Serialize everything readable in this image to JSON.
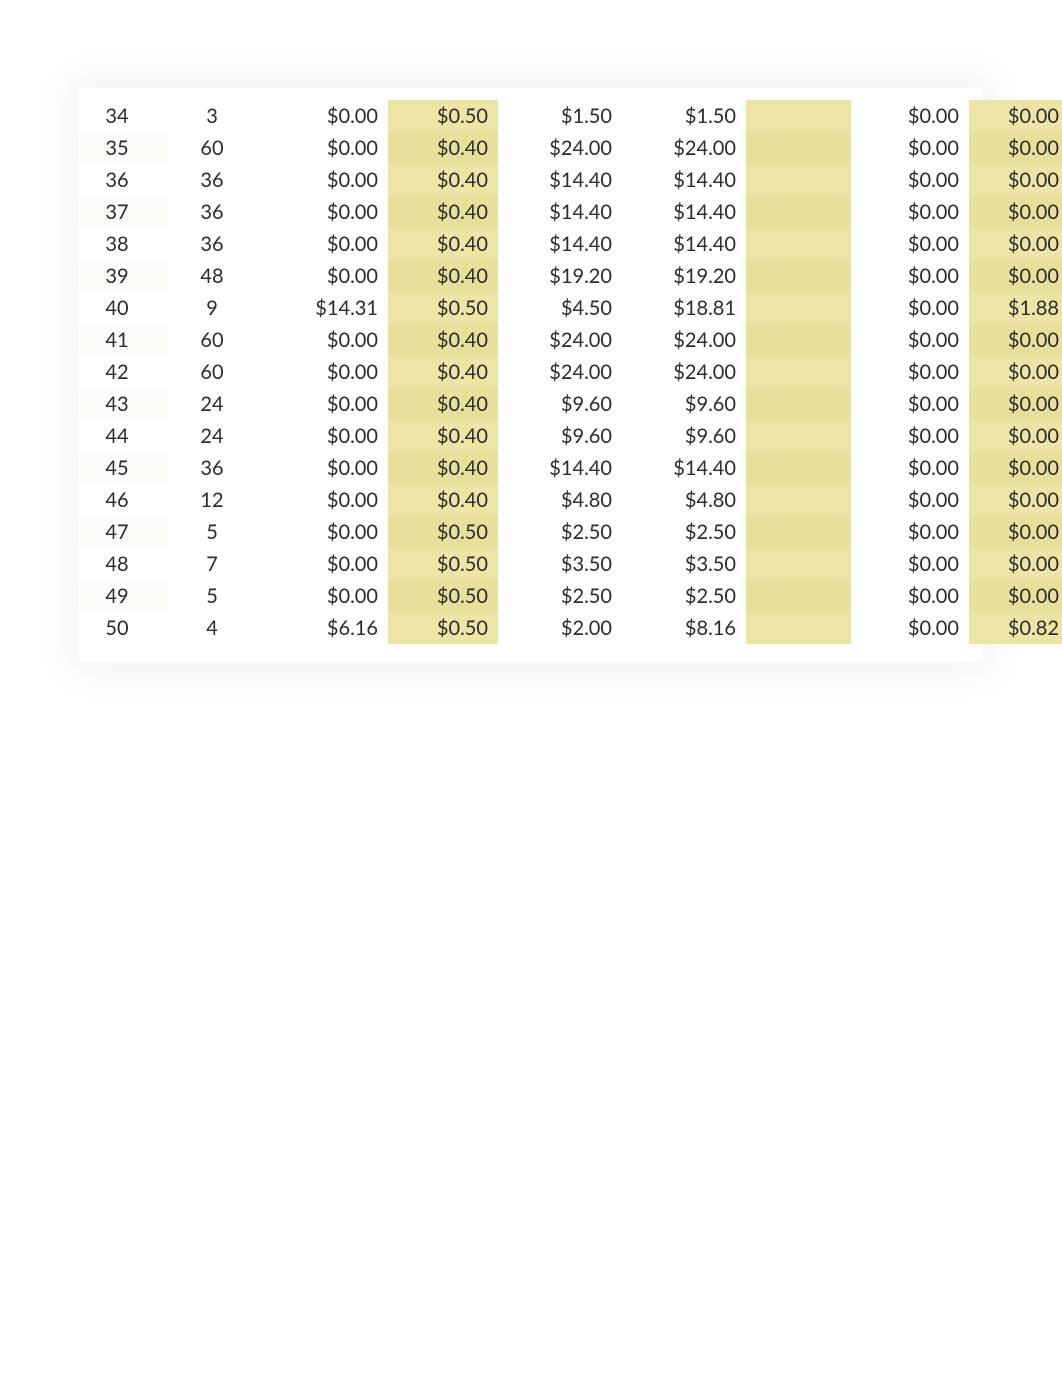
{
  "highlight_color": "#ece5a5",
  "columns": [
    "row",
    "qty",
    "c3",
    "c4",
    "c5",
    "c6",
    "c7",
    "c8",
    "c9"
  ],
  "rows": [
    {
      "row": "34",
      "qty": "3",
      "c3": "$0.00",
      "c4": "$0.50",
      "c5": "$1.50",
      "c6": "$1.50",
      "c7": "",
      "c8": "$0.00",
      "c9": "$0.00"
    },
    {
      "row": "35",
      "qty": "60",
      "c3": "$0.00",
      "c4": "$0.40",
      "c5": "$24.00",
      "c6": "$24.00",
      "c7": "",
      "c8": "$0.00",
      "c9": "$0.00"
    },
    {
      "row": "36",
      "qty": "36",
      "c3": "$0.00",
      "c4": "$0.40",
      "c5": "$14.40",
      "c6": "$14.40",
      "c7": "",
      "c8": "$0.00",
      "c9": "$0.00"
    },
    {
      "row": "37",
      "qty": "36",
      "c3": "$0.00",
      "c4": "$0.40",
      "c5": "$14.40",
      "c6": "$14.40",
      "c7": "",
      "c8": "$0.00",
      "c9": "$0.00"
    },
    {
      "row": "38",
      "qty": "36",
      "c3": "$0.00",
      "c4": "$0.40",
      "c5": "$14.40",
      "c6": "$14.40",
      "c7": "",
      "c8": "$0.00",
      "c9": "$0.00"
    },
    {
      "row": "39",
      "qty": "48",
      "c3": "$0.00",
      "c4": "$0.40",
      "c5": "$19.20",
      "c6": "$19.20",
      "c7": "",
      "c8": "$0.00",
      "c9": "$0.00"
    },
    {
      "row": "40",
      "qty": "9",
      "c3": "$14.31",
      "c4": "$0.50",
      "c5": "$4.50",
      "c6": "$18.81",
      "c7": "",
      "c8": "$0.00",
      "c9": "$1.88"
    },
    {
      "row": "41",
      "qty": "60",
      "c3": "$0.00",
      "c4": "$0.40",
      "c5": "$24.00",
      "c6": "$24.00",
      "c7": "",
      "c8": "$0.00",
      "c9": "$0.00"
    },
    {
      "row": "42",
      "qty": "60",
      "c3": "$0.00",
      "c4": "$0.40",
      "c5": "$24.00",
      "c6": "$24.00",
      "c7": "",
      "c8": "$0.00",
      "c9": "$0.00"
    },
    {
      "row": "43",
      "qty": "24",
      "c3": "$0.00",
      "c4": "$0.40",
      "c5": "$9.60",
      "c6": "$9.60",
      "c7": "",
      "c8": "$0.00",
      "c9": "$0.00"
    },
    {
      "row": "44",
      "qty": "24",
      "c3": "$0.00",
      "c4": "$0.40",
      "c5": "$9.60",
      "c6": "$9.60",
      "c7": "",
      "c8": "$0.00",
      "c9": "$0.00"
    },
    {
      "row": "45",
      "qty": "36",
      "c3": "$0.00",
      "c4": "$0.40",
      "c5": "$14.40",
      "c6": "$14.40",
      "c7": "",
      "c8": "$0.00",
      "c9": "$0.00"
    },
    {
      "row": "46",
      "qty": "12",
      "c3": "$0.00",
      "c4": "$0.40",
      "c5": "$4.80",
      "c6": "$4.80",
      "c7": "",
      "c8": "$0.00",
      "c9": "$0.00"
    },
    {
      "row": "47",
      "qty": "5",
      "c3": "$0.00",
      "c4": "$0.50",
      "c5": "$2.50",
      "c6": "$2.50",
      "c7": "",
      "c8": "$0.00",
      "c9": "$0.00"
    },
    {
      "row": "48",
      "qty": "7",
      "c3": "$0.00",
      "c4": "$0.50",
      "c5": "$3.50",
      "c6": "$3.50",
      "c7": "",
      "c8": "$0.00",
      "c9": "$0.00"
    },
    {
      "row": "49",
      "qty": "5",
      "c3": "$0.00",
      "c4": "$0.50",
      "c5": "$2.50",
      "c6": "$2.50",
      "c7": "",
      "c8": "$0.00",
      "c9": "$0.00"
    },
    {
      "row": "50",
      "qty": "4",
      "c3": "$6.16",
      "c4": "$0.50",
      "c5": "$2.00",
      "c6": "$8.16",
      "c7": "",
      "c8": "$0.00",
      "c9": "$0.82"
    }
  ]
}
